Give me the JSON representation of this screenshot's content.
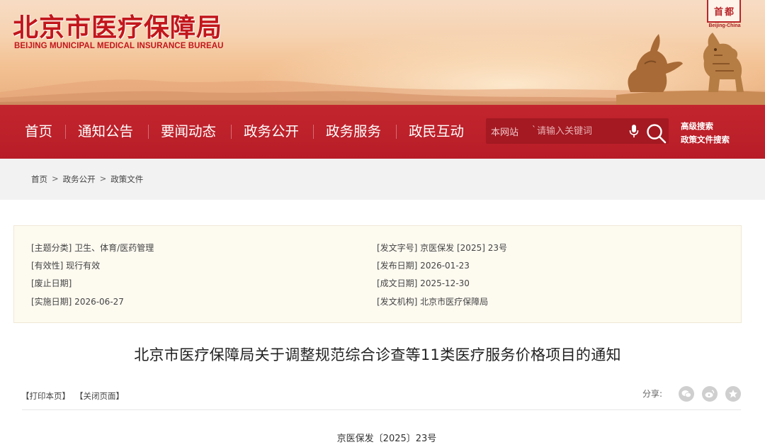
{
  "header": {
    "title": "北京市医疗保障局",
    "subtitle": "BEIJING MUNICIPAL MEDICAL INSURANCE BUREAU",
    "seal_chars": [
      "首",
      "都"
    ],
    "seal_caption": "Beijing-China"
  },
  "nav": {
    "items": [
      {
        "label": "首页"
      },
      {
        "label": "通知公告"
      },
      {
        "label": "要闻动态"
      },
      {
        "label": "政务公开"
      },
      {
        "label": "政务服务"
      },
      {
        "label": "政民互动"
      }
    ],
    "search": {
      "scope": "本网站",
      "placeholder": "请输入关键词"
    },
    "advanced_search": "高级搜索",
    "policy_search": "政策文件搜索"
  },
  "breadcrumb": [
    "首页",
    "政务公开",
    "政策文件"
  ],
  "meta": {
    "topic": "[主题分类] 卫生、体育/医药管理",
    "validity": "[有效性] 现行有效",
    "repeal_date": "[废止日期]",
    "effective_date": "[实施日期] 2026-06-27",
    "doc_no": "[发文字号] 京医保发 [2025] 23号",
    "publish_date": "[发布日期] 2026-01-23",
    "written_date": "[成文日期] 2025-12-30",
    "issuer": "[发文机构] 北京市医疗保障局"
  },
  "article": {
    "title": "北京市医疗保障局关于调整规范综合诊查等11类医疗服务价格项目的通知",
    "print_label": "【打印本页】",
    "close_label": "【关闭页面】",
    "share_label": "分享:",
    "doc_number": "京医保发〔2025〕23号"
  },
  "colors": {
    "brand_red": "#c2161c",
    "nav_red": "#b81d27",
    "meta_bg": "#fdfaf0"
  }
}
